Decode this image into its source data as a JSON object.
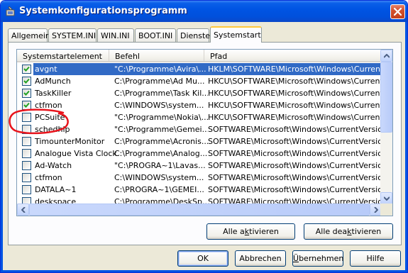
{
  "window": {
    "title": "Systemkonfigurationsprogramm",
    "close_label": "×"
  },
  "tabs": [
    {
      "label": "Allgemein"
    },
    {
      "label": "SYSTEM.INI"
    },
    {
      "label": "WIN.INI"
    },
    {
      "label": "BOOT.INI"
    },
    {
      "label": "Dienste"
    },
    {
      "label": "Systemstart"
    }
  ],
  "active_tab": "Systemstart",
  "columns": {
    "name": "Systemstartelement",
    "command": "Befehl",
    "path": "Pfad"
  },
  "rows": [
    {
      "checked": true,
      "name": "avgnt",
      "command": "\"C:\\Programme\\Avira\\...",
      "path": "HKLM\\SOFTWARE\\Microsoft\\Windows\\CurrentVer..."
    },
    {
      "checked": true,
      "name": "AdMunch",
      "command": "C:\\Programme\\Ad Mu...",
      "path": "HKCU\\SOFTWARE\\Microsoft\\Windows\\CurrentVer..."
    },
    {
      "checked": true,
      "name": "TaskKiller",
      "command": "C:\\Programme\\Task Kil...",
      "path": "HKCU\\SOFTWARE\\Microsoft\\Windows\\CurrentVer..."
    },
    {
      "checked": true,
      "name": "ctfmon",
      "command": "C:\\WINDOWS\\system...",
      "path": "HKCU\\SOFTWARE\\Microsoft\\Windows\\CurrentVer..."
    },
    {
      "checked": false,
      "name": "PCSuite",
      "command": "\"C:\\Programme\\Nokia\\...",
      "path": "HKCU\\SOFTWARE\\Microsoft\\Windows\\CurrentVer..."
    },
    {
      "checked": false,
      "name": "schedhlp",
      "command": "\"C:\\Programme\\Gemei...",
      "path": "SOFTWARE\\Microsoft\\Windows\\CurrentVersion\\Ru..."
    },
    {
      "checked": false,
      "name": "TimounterMonitor",
      "command": "C:\\Programme\\Acronis...",
      "path": "SOFTWARE\\Microsoft\\Windows\\CurrentVersion\\Ru..."
    },
    {
      "checked": false,
      "name": "Analogue Vista Clock",
      "command": "C:\\Programme\\Analog...",
      "path": "SOFTWARE\\Microsoft\\Windows\\CurrentVersion\\Ru..."
    },
    {
      "checked": false,
      "name": "Ad-Watch",
      "command": "\"C:\\PROGRA~1\\Lavas...",
      "path": "SOFTWARE\\Microsoft\\Windows\\CurrentVersion\\Ru..."
    },
    {
      "checked": false,
      "name": "ctfmon",
      "command": "C:\\WINDOWS\\system...",
      "path": "SOFTWARE\\Microsoft\\Windows\\CurrentVersion\\Ru..."
    },
    {
      "checked": false,
      "name": "DATALA~1",
      "command": "C:\\PROGRA~1\\GEMEI...",
      "path": "SOFTWARE\\Microsoft\\Windows\\CurrentVersion\\Ru..."
    },
    {
      "checked": false,
      "name": "deskspace",
      "command": "C:\\Programme\\DeskSp...",
      "path": "SOFTWARE\\Microsoft\\Windows\\CurrentVersion\\Ru..."
    }
  ],
  "selected_row": 0,
  "buttons": {
    "enable_all_pre": "Alle a",
    "enable_all_key": "k",
    "enable_all_post": "tivieren",
    "disable_all_pre": "Alle dea",
    "disable_all_key": "k",
    "disable_all_post": "tivieren",
    "ok": "OK",
    "cancel": "Abbrechen",
    "apply_key": "Ü",
    "apply_post": "bernehmen",
    "help": "Hilfe"
  },
  "colors": {
    "titlebar": "#0054e3",
    "selection": "#316ac5",
    "annotation": "#e8141c",
    "checkmark": "#21a121"
  },
  "icons": {
    "app": "msconfig-app-icon",
    "close": "close-icon",
    "check": "checkmark-icon"
  }
}
